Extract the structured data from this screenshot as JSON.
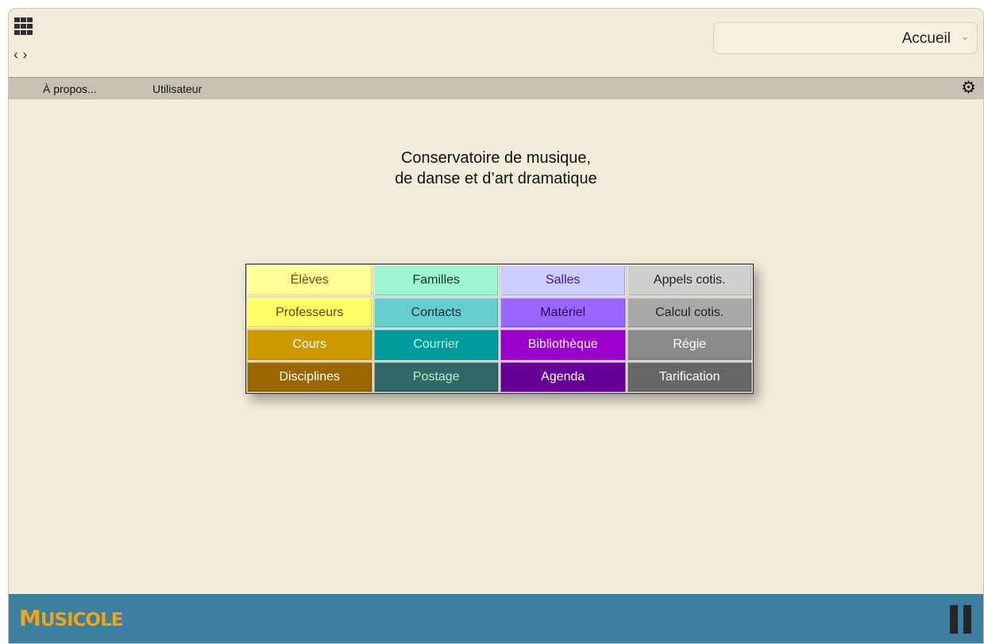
{
  "header": {
    "page_select": {
      "value": "Accueil"
    }
  },
  "menubar": {
    "items": [
      {
        "label": "À propos..."
      },
      {
        "label": "Utilisateur"
      }
    ]
  },
  "main": {
    "title_line1": "Conservatoire de musique,",
    "title_line2": "de danse et d’art dramatique"
  },
  "tiles": [
    {
      "label": "Élèves",
      "bg": "#ffff99",
      "color": "#7a4a00"
    },
    {
      "label": "Familles",
      "bg": "#9df5d2",
      "color": "#0b3a2a"
    },
    {
      "label": "Salles",
      "bg": "#cccdfc",
      "color": "#3a1a8a"
    },
    {
      "label": "Appels cotis.",
      "bg": "#cfcfcf",
      "color": "#222222"
    },
    {
      "label": "Professeurs",
      "bg": "#ffff66",
      "color": "#6a3e00"
    },
    {
      "label": "Contacts",
      "bg": "#68cdcd",
      "color": "#0f2e33"
    },
    {
      "label": "Matériel",
      "bg": "#9966ff",
      "color": "#2a0a55"
    },
    {
      "label": "Calcul cotis.",
      "bg": "#a9a9a9",
      "color": "#222222"
    },
    {
      "label": "Cours",
      "bg": "#cc9900",
      "color": "#ffffff"
    },
    {
      "label": "Courrier",
      "bg": "#009c9c",
      "color": "#bff5e0"
    },
    {
      "label": "Bibliothèque",
      "bg": "#9900cc",
      "color": "#ffffff"
    },
    {
      "label": "Régie",
      "bg": "#8a8a8a",
      "color": "#ffffff"
    },
    {
      "label": "Disciplines",
      "bg": "#996600",
      "color": "#ffffff"
    },
    {
      "label": "Postage",
      "bg": "#336666",
      "color": "#a8f5c8"
    },
    {
      "label": "Agenda",
      "bg": "#660099",
      "color": "#ffffff"
    },
    {
      "label": "Tarification",
      "bg": "#666666",
      "color": "#ffffff"
    }
  ],
  "footer": {
    "logo_first": "M",
    "logo_rest": "USICOLE"
  }
}
